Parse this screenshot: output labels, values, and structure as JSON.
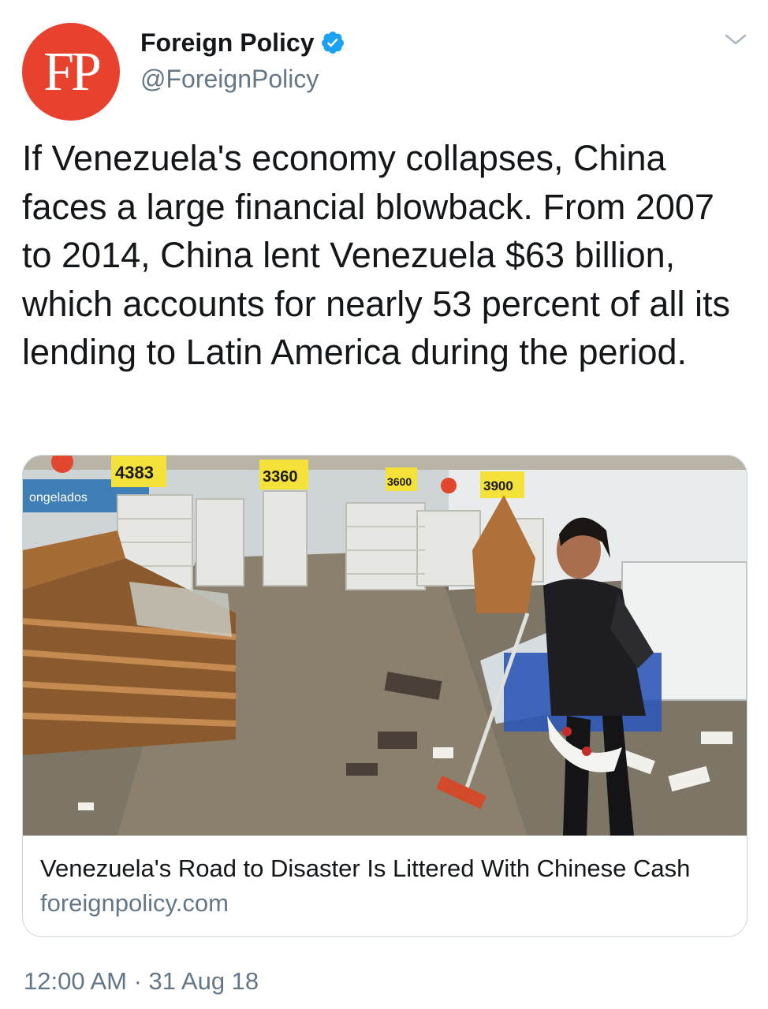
{
  "tweet": {
    "author": {
      "avatar_text": "FP",
      "display_name": "Foreign Policy",
      "handle": "@ForeignPolicy",
      "verified": true,
      "verified_icon": "verified-badge-icon",
      "avatar_color": "#e8412e"
    },
    "menu_icon": "chevron-down-icon",
    "text": "If Venezuela's economy collapses, China faces a large financial blowback. From 2007 to 2014, China lent Venezuela $63 billion, which accounts for nearly 53 percent of all its lending to Latin America during the period.",
    "card": {
      "image_description_icon": "photo-looted-supermarket",
      "price_tags": [
        "4383",
        "3360",
        "3600",
        "3900"
      ],
      "sign_text": "ongelados",
      "title": "Venezuela's Road to Disaster Is Littered With Chinese Cash",
      "domain": "foreignpolicy.com"
    },
    "timestamp": "12:00 AM · 31 Aug 18"
  },
  "colors": {
    "text_primary": "#14171a",
    "text_secondary": "#657786",
    "verified_blue": "#1da1f2",
    "card_border": "#ccd6dd"
  }
}
